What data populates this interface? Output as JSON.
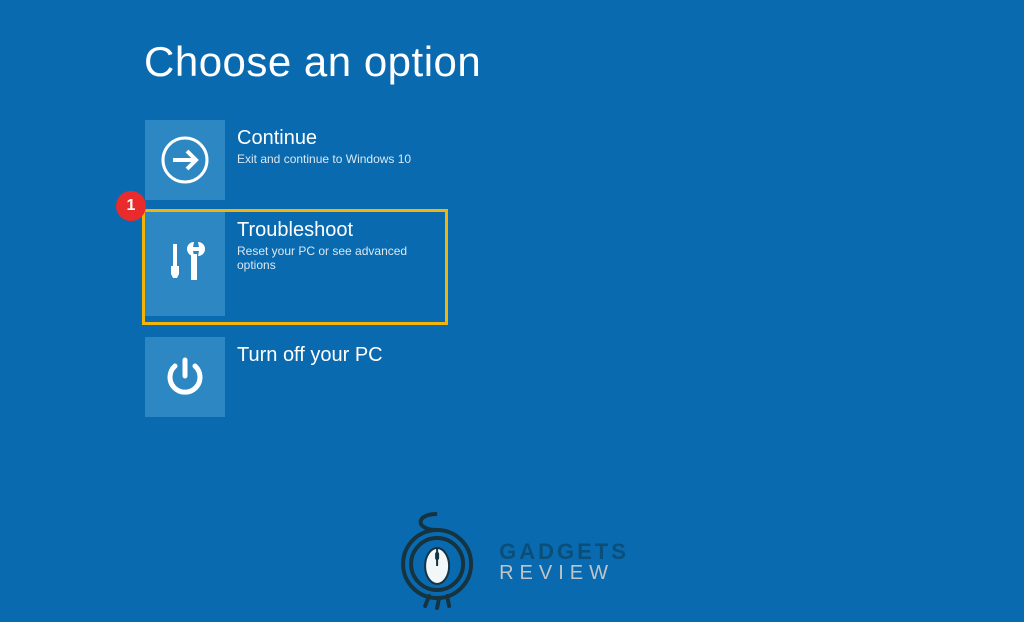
{
  "title": "Choose an option",
  "options": [
    {
      "id": "continue",
      "title": "Continue",
      "desc": "Exit and continue to Windows 10",
      "icon": "arrow-right",
      "highlighted": false
    },
    {
      "id": "troubleshoot",
      "title": "Troubleshoot",
      "desc": "Reset your PC or see advanced options",
      "icon": "tools",
      "highlighted": true
    },
    {
      "id": "turnoff",
      "title": "Turn off your PC",
      "desc": "",
      "icon": "power",
      "highlighted": false
    }
  ],
  "annotation": {
    "badge_number": "1"
  },
  "watermark": {
    "line1": "GADGETS",
    "line2": "REVIEW"
  },
  "colors": {
    "background": "#0a6ab0",
    "tile": "#2d87c3",
    "highlight_border": "#f3b40a",
    "badge": "#ea2b2b"
  }
}
